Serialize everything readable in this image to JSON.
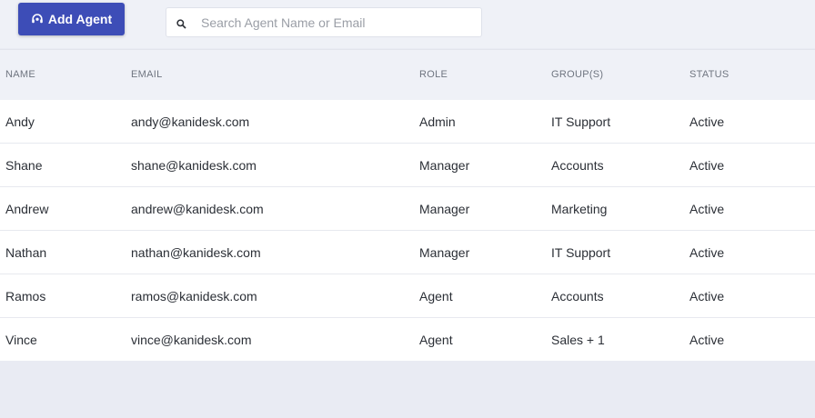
{
  "toolbar": {
    "add_button_label": "Add Agent",
    "search_placeholder": "Search Agent Name or Email",
    "search_value": ""
  },
  "table": {
    "headers": {
      "name": "NAME",
      "email": "EMAIL",
      "role": "ROLE",
      "groups": "GROUP(S)",
      "status": "STATUS"
    },
    "rows": [
      {
        "name": "Andy",
        "email": "andy@kanidesk.com",
        "role": "Admin",
        "groups": "IT Support",
        "status": "Active"
      },
      {
        "name": "Shane",
        "email": "shane@kanidesk.com",
        "role": "Manager",
        "groups": "Accounts",
        "status": "Active"
      },
      {
        "name": "Andrew",
        "email": "andrew@kanidesk.com",
        "role": "Manager",
        "groups": "Marketing",
        "status": "Active"
      },
      {
        "name": "Nathan",
        "email": "nathan@kanidesk.com",
        "role": "Manager",
        "groups": "IT Support",
        "status": "Active"
      },
      {
        "name": "Ramos",
        "email": "ramos@kanidesk.com",
        "role": "Agent",
        "groups": "Accounts",
        "status": "Active"
      },
      {
        "name": "Vince",
        "email": "vince@kanidesk.com",
        "role": "Agent",
        "groups": "Sales + 1",
        "status": "Active"
      }
    ]
  },
  "icons": {
    "add_button_icon": "headset-icon",
    "search_icon": "search-icon"
  },
  "colors": {
    "accent": "#3d4db7",
    "page_background": "#e9ebf3",
    "header_background": "#eff1f7"
  }
}
